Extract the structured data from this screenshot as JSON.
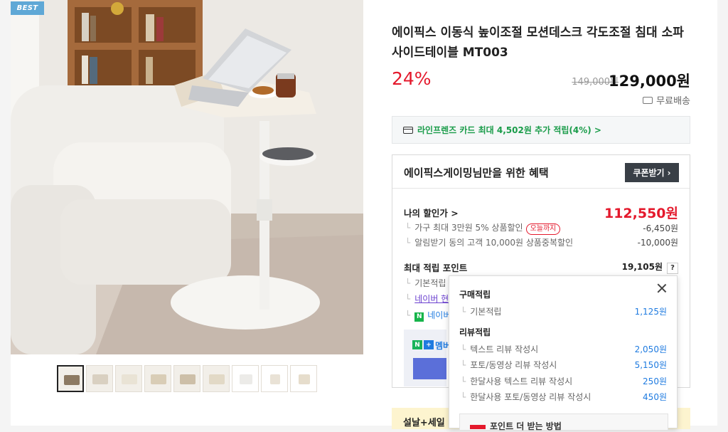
{
  "gallery": {
    "badge": "BEST",
    "thumb_count": 9,
    "active_thumb": 0
  },
  "product": {
    "title": "에이픽스 이동식 높이조절 모션데스크 각도조절 침대 소파 사이드테이블 MT003",
    "discount": "24%",
    "original_price": "149,000원",
    "final_price": "129,000원",
    "shipping": "무료배송"
  },
  "card_promo": "라인프렌즈 카드 최대 4,502원 추가 적립(4%) >",
  "benefit": {
    "title": "에이픽스게이밍님만을 위한 혜택",
    "coupon_button": "쿠폰받기",
    "my_price_label": "나의 할인가 >",
    "my_price_value": "112,550원",
    "discounts": [
      {
        "label": "가구 최대 3만원 5% 상품할인",
        "badge": "오늘까지",
        "value": "-6,450원"
      },
      {
        "label": "알림받기 동의 고객 10,000원 상품중복할인",
        "value": "-10,000원"
      }
    ],
    "points_label": "최대 적립 포인트",
    "points_value": "19,105원",
    "points_help": "?",
    "points_sub": [
      "기본적립",
      "네이버 현",
      "네이버"
    ],
    "naver_member": "멤버"
  },
  "promo_banner": "설날+세일",
  "popover": {
    "purchase_title": "구매적립",
    "purchase_rows": [
      {
        "label": "기본적립",
        "value": "1,125원"
      }
    ],
    "review_title": "리뷰적립",
    "review_rows": [
      {
        "label": "텍스트 리뷰 작성시",
        "value": "2,050원"
      },
      {
        "label": "포토/동영상 리뷰 작성시",
        "value": "5,150원"
      },
      {
        "label": "한달사용 텍스트 리뷰 작성시",
        "value": "250원"
      },
      {
        "label": "한달사용 포토/동영상 리뷰 작성시",
        "value": "450원"
      }
    ],
    "bottom_text": "포인트 더 받는 방법"
  },
  "colors": {
    "sale_red": "#e4192c",
    "naver_green": "#16b44a",
    "points_blue": "#1f7be0",
    "coupon_dark": "#393f46"
  }
}
